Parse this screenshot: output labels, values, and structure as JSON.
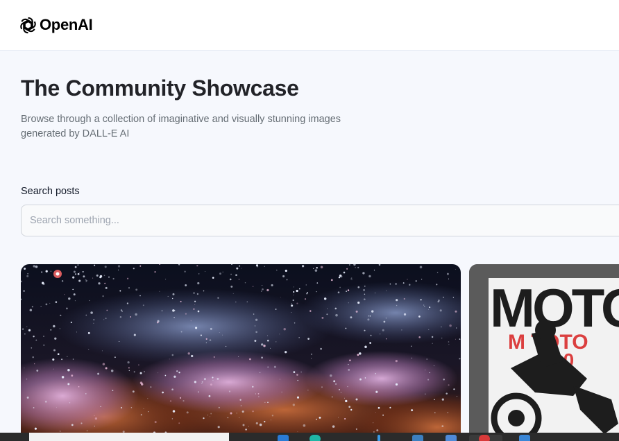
{
  "header": {
    "logo_text": "OpenAI",
    "logo_icon": "openai-logo-icon"
  },
  "main": {
    "title": "The Community Showcase",
    "subtitle": "Browse through a collection of imaginative and visually stunning images generated by DALL-E AI"
  },
  "search": {
    "label": "Search posts",
    "placeholder": "Search something...",
    "value": ""
  },
  "gallery": {
    "cards": [
      {
        "image": "galaxy-nebula-image"
      },
      {
        "image": "motocross-poster-image",
        "poster_text": "MOTO"
      }
    ]
  },
  "colors": {
    "background": "#f6f8fd",
    "header_bg": "#ffffff",
    "title": "#222328",
    "subtitle": "#666e75",
    "input_border": "#d1d5db"
  }
}
